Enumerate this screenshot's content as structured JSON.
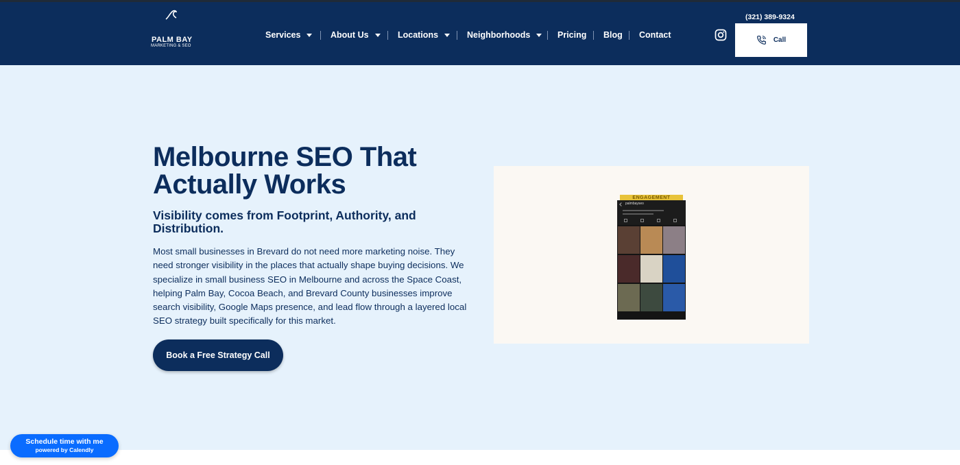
{
  "header": {
    "logo": {
      "title": "PALM BAY",
      "subtitle": "MARKETING & SEO"
    },
    "nav": [
      {
        "label": "Services",
        "has_dropdown": true
      },
      {
        "label": "About Us",
        "has_dropdown": true
      },
      {
        "label": "Locations",
        "has_dropdown": true
      },
      {
        "label": "Neighborhoods",
        "has_dropdown": true
      },
      {
        "label": "Pricing",
        "has_dropdown": false
      },
      {
        "label": "Blog",
        "has_dropdown": false
      },
      {
        "label": "Contact",
        "has_dropdown": false
      }
    ],
    "phone": "(321) 389-9324",
    "social_icon": "instagram-icon",
    "call_button": {
      "label": "Call",
      "icon": "phone-icon"
    }
  },
  "hero": {
    "title": "Melbourne SEO That Actually Works",
    "subtitle": "Visibility comes from Footprint, Authority, and Distribution.",
    "body": "Most small businesses in Brevard do not need more marketing noise. They need stronger visibility in the places that actually shape buying decisions. We specialize in small business SEO in Melbourne and across the Space Coast, helping Palm Bay, Cocoa Beach, and Brevard County businesses improve search visibility, Google Maps presence, and lead flow through a layered local SEO strategy built specifically for this market.",
    "cta_label": "Book a Free Strategy Call",
    "media": {
      "banner": "ENGAGEMENT",
      "profile_handle": "palmbayseo"
    }
  },
  "calendly": {
    "main": "Schedule time with me",
    "sub": "powered by Calendly"
  },
  "colors": {
    "navy": "#0c2d5c",
    "hero_bg": "#e6f2fc",
    "media_bg": "#fbf8f3",
    "calendly_blue": "#0a6cff"
  }
}
